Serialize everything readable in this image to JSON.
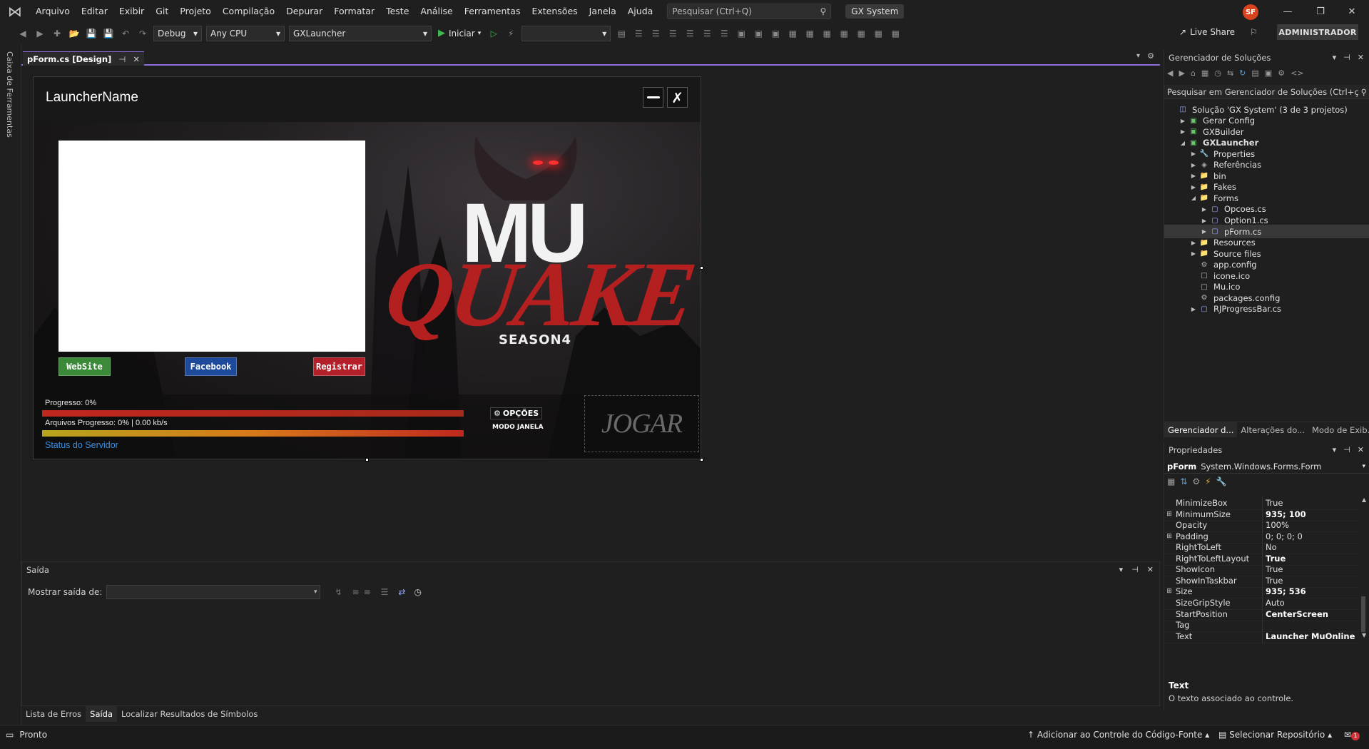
{
  "menubar": {
    "items": [
      "Arquivo",
      "Editar",
      "Exibir",
      "Git",
      "Projeto",
      "Compilação",
      "Depurar",
      "Formatar",
      "Teste",
      "Análise",
      "Ferramentas",
      "Extensões",
      "Janela",
      "Ajuda"
    ],
    "search_placeholder": "Pesquisar (Ctrl+Q)",
    "solution_name": "GX System",
    "avatar_initials": "SF",
    "logo_icon": "visual-studio-logo"
  },
  "toolbar": {
    "config": "Debug",
    "platform": "Any CPU",
    "startup_project": "GXLauncher",
    "start_label": "Iniciar",
    "live_share": "Live Share",
    "admin_label": "ADMINISTRADOR"
  },
  "left_rail": {
    "label": "Caixa de Ferramentas"
  },
  "document": {
    "tab_label": "pForm.cs [Design]"
  },
  "launcher": {
    "title": "LauncherName",
    "website": "WebSite",
    "facebook": "Facebook",
    "register": "Registrar",
    "logo_top": "MU",
    "logo_main": "QUAKE",
    "logo_season": "SEASON4",
    "progress_label": "Progresso: 0%",
    "files_label": "Arquivos Progresso: 0%  |  0.00 kb/s",
    "status_server": "Status do Servidor",
    "options": "OPÇÕES",
    "window_mode": "MODO JANELA",
    "play": "JOGAR",
    "progress_value": 0,
    "files_progress_value": 0
  },
  "output": {
    "title": "Saída",
    "show_from": "Mostrar saída de:"
  },
  "bottom_tabs": [
    "Lista de Erros",
    "Saída",
    "Localizar Resultados de Símbolos"
  ],
  "solution_explorer": {
    "title": "Gerenciador de Soluções",
    "search_placeholder": "Pesquisar em Gerenciador de Soluções (Ctrl+ç",
    "tree": [
      {
        "label": "Solução 'GX System' (3 de 3 projetos)",
        "level": 0,
        "arrow": "",
        "icon": "solution"
      },
      {
        "label": "Gerar Config",
        "level": 1,
        "arrow": "▶",
        "icon": "project"
      },
      {
        "label": "GXBuilder",
        "level": 1,
        "arrow": "▶",
        "icon": "project"
      },
      {
        "label": "GXLauncher",
        "level": 1,
        "arrow": "◢",
        "icon": "project",
        "bold": true
      },
      {
        "label": "Properties",
        "level": 2,
        "arrow": "▶",
        "icon": "wrench"
      },
      {
        "label": "Referências",
        "level": 2,
        "arrow": "▶",
        "icon": "references"
      },
      {
        "label": "bin",
        "level": 2,
        "arrow": "▶",
        "icon": "folder"
      },
      {
        "label": "Fakes",
        "level": 2,
        "arrow": "▶",
        "icon": "folder"
      },
      {
        "label": "Forms",
        "level": 2,
        "arrow": "◢",
        "icon": "folder"
      },
      {
        "label": "Opcoes.cs",
        "level": 3,
        "arrow": "▶",
        "icon": "form"
      },
      {
        "label": "Option1.cs",
        "level": 3,
        "arrow": "▶",
        "icon": "form"
      },
      {
        "label": "pForm.cs",
        "level": 3,
        "arrow": "▶",
        "icon": "form",
        "selected": true
      },
      {
        "label": "Resources",
        "level": 2,
        "arrow": "▶",
        "icon": "folder"
      },
      {
        "label": "Source files",
        "level": 2,
        "arrow": "▶",
        "icon": "folder"
      },
      {
        "label": "app.config",
        "level": 2,
        "arrow": "",
        "icon": "config"
      },
      {
        "label": "icone.ico",
        "level": 2,
        "arrow": "",
        "icon": "file"
      },
      {
        "label": "Mu.ico",
        "level": 2,
        "arrow": "",
        "icon": "file"
      },
      {
        "label": "packages.config",
        "level": 2,
        "arrow": "",
        "icon": "config"
      },
      {
        "label": "RJProgressBar.cs",
        "level": 2,
        "arrow": "▶",
        "icon": "cs"
      }
    ],
    "tabs": [
      "Gerenciador d...",
      "Alterações do...",
      "Modo de Exib..."
    ]
  },
  "properties": {
    "title": "Propriedades",
    "object_name": "pForm",
    "object_type": "System.Windows.Forms.Form",
    "rows": [
      {
        "name": "MinimizeBox",
        "value": "True",
        "expand": false,
        "bold": false
      },
      {
        "name": "MinimumSize",
        "value": "935; 100",
        "expand": true,
        "bold": true
      },
      {
        "name": "Opacity",
        "value": "100%",
        "expand": false,
        "bold": false
      },
      {
        "name": "Padding",
        "value": "0; 0; 0; 0",
        "expand": true,
        "bold": false
      },
      {
        "name": "RightToLeft",
        "value": "No",
        "expand": false,
        "bold": false
      },
      {
        "name": "RightToLeftLayout",
        "value": "True",
        "expand": false,
        "bold": true
      },
      {
        "name": "ShowIcon",
        "value": "True",
        "expand": false,
        "bold": false
      },
      {
        "name": "ShowInTaskbar",
        "value": "True",
        "expand": false,
        "bold": false
      },
      {
        "name": "Size",
        "value": "935; 536",
        "expand": true,
        "bold": true
      },
      {
        "name": "SizeGripStyle",
        "value": "Auto",
        "expand": false,
        "bold": false
      },
      {
        "name": "StartPosition",
        "value": "CenterScreen",
        "expand": false,
        "bold": true
      },
      {
        "name": "Tag",
        "value": "",
        "expand": false,
        "bold": false
      },
      {
        "name": "Text",
        "value": "Launcher MuOnline",
        "expand": false,
        "bold": true
      }
    ],
    "desc_title": "Text",
    "desc_text": "O texto associado ao controle."
  },
  "statusbar": {
    "ready": "Pronto",
    "add_source_control": "Adicionar ao Controle do Código-Fonte",
    "select_repo": "Selecionar Repositório",
    "notification_count": "1"
  },
  "colors": {
    "accent": "#8c6ddb",
    "website_btn": "#3b8a3a",
    "facebook_btn": "#1e4a9c",
    "register_btn": "#b3202a",
    "progress_red": "#c0281e",
    "progress_orange": "#d87a1a"
  }
}
